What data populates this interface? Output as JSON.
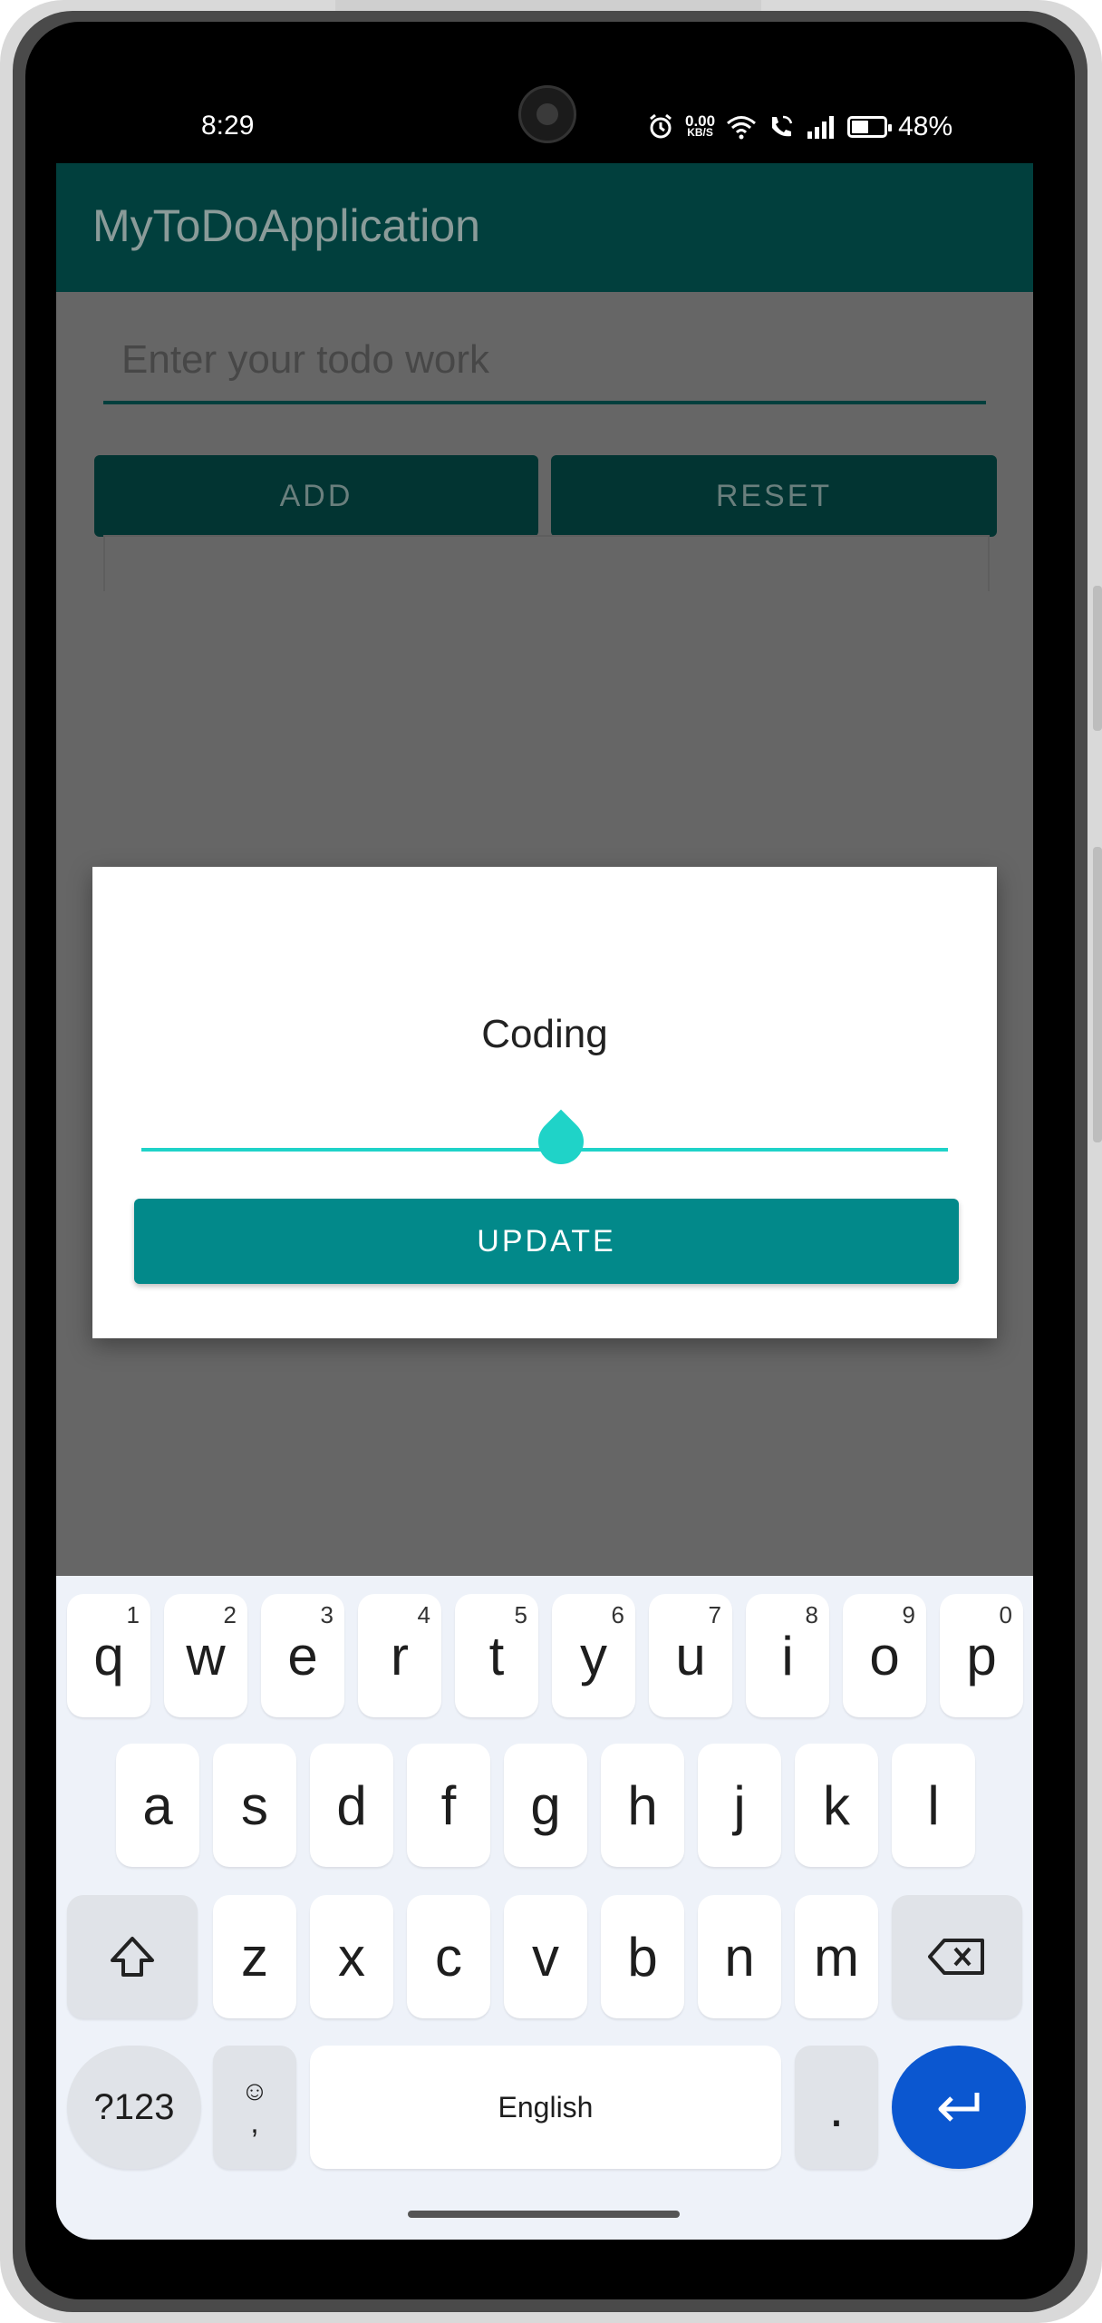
{
  "status_bar": {
    "time": "8:29",
    "net_speed_value": "0.00",
    "net_speed_unit": "KB/S",
    "battery": "48%",
    "icons": [
      "alarm-icon",
      "wifi-icon",
      "wifi-call-icon",
      "signal-icon",
      "battery-icon"
    ]
  },
  "app_bar": {
    "title": "MyToDoApplication"
  },
  "main": {
    "todo_input_placeholder": "Enter your todo work",
    "add_label": "ADD",
    "reset_label": "RESET"
  },
  "dialog": {
    "edit_value": "Coding",
    "update_label": "UPDATE"
  },
  "keyboard": {
    "row1": [
      {
        "key": "q",
        "hint": "1"
      },
      {
        "key": "w",
        "hint": "2"
      },
      {
        "key": "e",
        "hint": "3"
      },
      {
        "key": "r",
        "hint": "4"
      },
      {
        "key": "t",
        "hint": "5"
      },
      {
        "key": "y",
        "hint": "6"
      },
      {
        "key": "u",
        "hint": "7"
      },
      {
        "key": "i",
        "hint": "8"
      },
      {
        "key": "o",
        "hint": "9"
      },
      {
        "key": "p",
        "hint": "0"
      }
    ],
    "row2": [
      "a",
      "s",
      "d",
      "f",
      "g",
      "h",
      "j",
      "k",
      "l"
    ],
    "row3": [
      "z",
      "x",
      "c",
      "v",
      "b",
      "n",
      "m"
    ],
    "symbols_label": "?123",
    "emoji_symbol": "☺",
    "comma_label": ",",
    "space_label": "English",
    "period_label": "."
  },
  "colors": {
    "app_bar": "#013f3d",
    "accent": "#1fd3c8",
    "update_button": "#02898a",
    "enter_key": "#0b57d0"
  }
}
